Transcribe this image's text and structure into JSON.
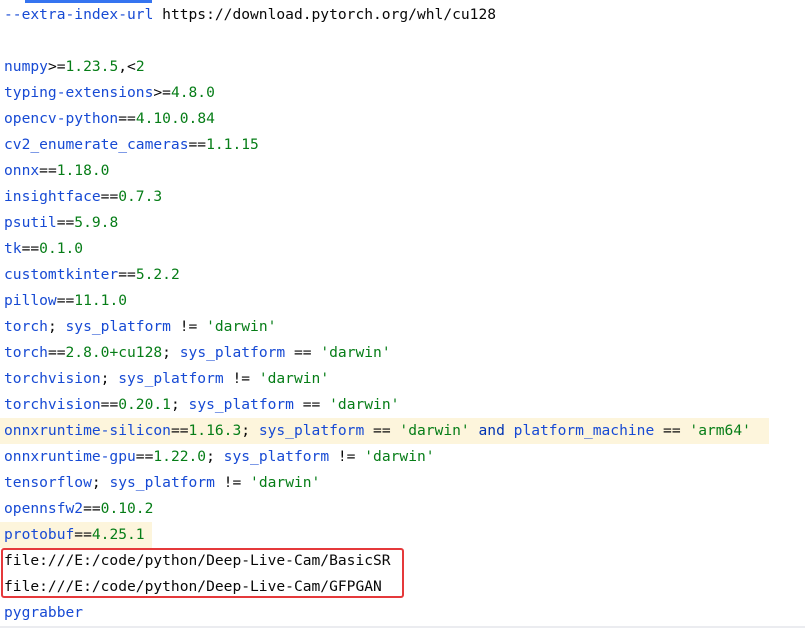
{
  "editor": {
    "lines": [
      {
        "segments": [
          {
            "t": "--extra-index-url ",
            "c": "k"
          },
          {
            "t": "https://download.pytorch.org/whl/cu128",
            "c": "plain"
          }
        ]
      },
      {
        "segments": []
      },
      {
        "segments": [
          {
            "t": "numpy",
            "c": "k"
          },
          {
            "t": ">=",
            "c": "o"
          },
          {
            "t": "1.23.5",
            "c": "v"
          },
          {
            "t": ",",
            "c": "o"
          },
          {
            "t": "<",
            "c": "o"
          },
          {
            "t": "2",
            "c": "v"
          }
        ]
      },
      {
        "segments": [
          {
            "t": "typing-extensions",
            "c": "k"
          },
          {
            "t": ">=",
            "c": "o"
          },
          {
            "t": "4.8.0",
            "c": "v"
          }
        ]
      },
      {
        "segments": [
          {
            "t": "opencv-python",
            "c": "k"
          },
          {
            "t": "==",
            "c": "o"
          },
          {
            "t": "4.10.0.84",
            "c": "v"
          }
        ]
      },
      {
        "segments": [
          {
            "t": "cv2_enumerate_cameras",
            "c": "k"
          },
          {
            "t": "==",
            "c": "o"
          },
          {
            "t": "1.1.15",
            "c": "v"
          }
        ]
      },
      {
        "segments": [
          {
            "t": "onnx",
            "c": "k"
          },
          {
            "t": "==",
            "c": "o"
          },
          {
            "t": "1.18.0",
            "c": "v"
          }
        ]
      },
      {
        "segments": [
          {
            "t": "insightface",
            "c": "k"
          },
          {
            "t": "==",
            "c": "o"
          },
          {
            "t": "0.7.3",
            "c": "v"
          }
        ]
      },
      {
        "segments": [
          {
            "t": "psutil",
            "c": "k"
          },
          {
            "t": "==",
            "c": "o"
          },
          {
            "t": "5.9.8",
            "c": "v"
          }
        ]
      },
      {
        "segments": [
          {
            "t": "tk",
            "c": "k"
          },
          {
            "t": "==",
            "c": "o"
          },
          {
            "t": "0.1.0",
            "c": "v"
          }
        ]
      },
      {
        "segments": [
          {
            "t": "customtkinter",
            "c": "k"
          },
          {
            "t": "==",
            "c": "o"
          },
          {
            "t": "5.2.2",
            "c": "v"
          }
        ]
      },
      {
        "segments": [
          {
            "t": "pillow",
            "c": "k"
          },
          {
            "t": "==",
            "c": "o"
          },
          {
            "t": "11.1.0",
            "c": "v"
          }
        ]
      },
      {
        "segments": [
          {
            "t": "torch",
            "c": "k"
          },
          {
            "t": "; ",
            "c": "o"
          },
          {
            "t": "sys_platform",
            "c": "k"
          },
          {
            "t": " != ",
            "c": "o"
          },
          {
            "t": "'darwin'",
            "c": "v"
          }
        ]
      },
      {
        "segments": [
          {
            "t": "torch",
            "c": "k"
          },
          {
            "t": "==",
            "c": "o"
          },
          {
            "t": "2.8.0+cu128",
            "c": "v"
          },
          {
            "t": "; ",
            "c": "o"
          },
          {
            "t": "sys_platform",
            "c": "k"
          },
          {
            "t": " == ",
            "c": "o"
          },
          {
            "t": "'darwin'",
            "c": "v"
          }
        ]
      },
      {
        "segments": [
          {
            "t": "torchvision",
            "c": "k"
          },
          {
            "t": "; ",
            "c": "o"
          },
          {
            "t": "sys_platform",
            "c": "k"
          },
          {
            "t": " != ",
            "c": "o"
          },
          {
            "t": "'darwin'",
            "c": "v"
          }
        ]
      },
      {
        "segments": [
          {
            "t": "torchvision",
            "c": "k"
          },
          {
            "t": "==",
            "c": "o"
          },
          {
            "t": "0.20.1",
            "c": "v"
          },
          {
            "t": "; ",
            "c": "o"
          },
          {
            "t": "sys_platform",
            "c": "k"
          },
          {
            "t": " == ",
            "c": "o"
          },
          {
            "t": "'darwin'",
            "c": "v"
          }
        ]
      },
      {
        "highlight": "long",
        "segments": [
          {
            "t": "onnxruntime-silicon",
            "c": "k"
          },
          {
            "t": "==",
            "c": "o"
          },
          {
            "t": "1.16.3",
            "c": "v"
          },
          {
            "t": "; ",
            "c": "o"
          },
          {
            "t": "sys_platform",
            "c": "k"
          },
          {
            "t": " == ",
            "c": "o"
          },
          {
            "t": "'darwin'",
            "c": "v"
          },
          {
            "t": " ",
            "c": "o"
          },
          {
            "t": "and",
            "c": "c"
          },
          {
            "t": " ",
            "c": "o"
          },
          {
            "t": "platform_machine",
            "c": "k"
          },
          {
            "t": " == ",
            "c": "o"
          },
          {
            "t": "'arm64'",
            "c": "v"
          }
        ]
      },
      {
        "segments": [
          {
            "t": "onnxruntime-gpu",
            "c": "k"
          },
          {
            "t": "==",
            "c": "o"
          },
          {
            "t": "1.22.0",
            "c": "v"
          },
          {
            "t": "; ",
            "c": "o"
          },
          {
            "t": "sys_platform",
            "c": "k"
          },
          {
            "t": " != ",
            "c": "o"
          },
          {
            "t": "'darwin'",
            "c": "v"
          }
        ]
      },
      {
        "segments": [
          {
            "t": "tensorflow",
            "c": "k"
          },
          {
            "t": "; ",
            "c": "o"
          },
          {
            "t": "sys_platform",
            "c": "k"
          },
          {
            "t": " != ",
            "c": "o"
          },
          {
            "t": "'darwin'",
            "c": "v"
          }
        ]
      },
      {
        "segments": [
          {
            "t": "opennsfw2",
            "c": "k"
          },
          {
            "t": "==",
            "c": "o"
          },
          {
            "t": "0.10.2",
            "c": "v"
          }
        ]
      },
      {
        "highlight": "short",
        "segments": [
          {
            "t": "protobuf",
            "c": "k"
          },
          {
            "t": "==",
            "c": "o"
          },
          {
            "t": "4.25.1",
            "c": "v"
          }
        ]
      },
      {
        "segments": [
          {
            "t": "file:///E:/code/python/Deep-Live-Cam/BasicSR",
            "c": "plain"
          }
        ]
      },
      {
        "segments": [
          {
            "t": "file:///E:/code/python/Deep-Live-Cam/GFPGAN",
            "c": "plain"
          }
        ]
      },
      {
        "segments": [
          {
            "t": "pygrabber",
            "c": "k"
          }
        ]
      }
    ]
  },
  "colors": {
    "keyword": "#174ad4",
    "value": "#067d17",
    "highlight_bg": "#fdf5dc",
    "selection_border": "#e5393b"
  }
}
